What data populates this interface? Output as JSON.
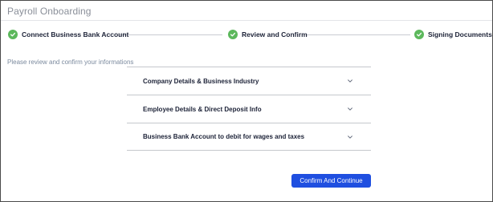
{
  "header": {
    "title": "Payroll Onboarding"
  },
  "stepper": {
    "steps": [
      {
        "label": "Connect Business Bank Account",
        "status": "complete",
        "icon": "check-circle-icon"
      },
      {
        "label": "Review and Confirm",
        "status": "complete",
        "icon": "check-circle-icon"
      },
      {
        "label": "Signing Documents",
        "status": "complete",
        "icon": "check-circle-icon"
      }
    ],
    "colors": {
      "complete": "#5cb85c",
      "connector": "#c9ccd2"
    }
  },
  "main": {
    "instruction": "Please review and confirm your informations",
    "sections": [
      {
        "label": "Company Details & Business Industry",
        "icon": "chevron-down-icon"
      },
      {
        "label": "Employee Details & Direct Deposit Info",
        "icon": "chevron-down-icon"
      },
      {
        "label": "Business Bank Account to debit for wages and taxes",
        "icon": "chevron-down-icon"
      }
    ],
    "confirm_label": "Confirm And Continue"
  },
  "colors": {
    "primary": "#1f4fe0",
    "text": "#1c2237",
    "muted": "#8a8f99"
  }
}
